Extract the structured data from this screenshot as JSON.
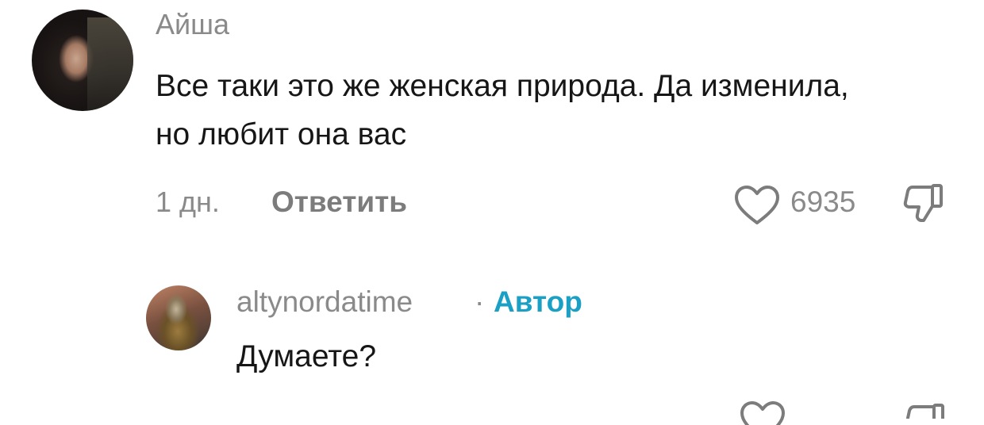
{
  "comment": {
    "author": "Айша",
    "text": "Все таки это же женская природа. Да изменила, но любит она вас",
    "time": "1 дн.",
    "reply_label": "Ответить",
    "likes": "6935",
    "like_icon": "heart-outline-icon",
    "dislike_icon": "thumbs-down-icon"
  },
  "reply": {
    "author": "altynordatime",
    "separator": "·",
    "badge": "Автор",
    "text": "Думаете?"
  },
  "colors": {
    "text": "#161616",
    "muted": "#8a8a8a",
    "reply_button": "#7c7c7c",
    "author_badge": "#1aa0c5"
  }
}
